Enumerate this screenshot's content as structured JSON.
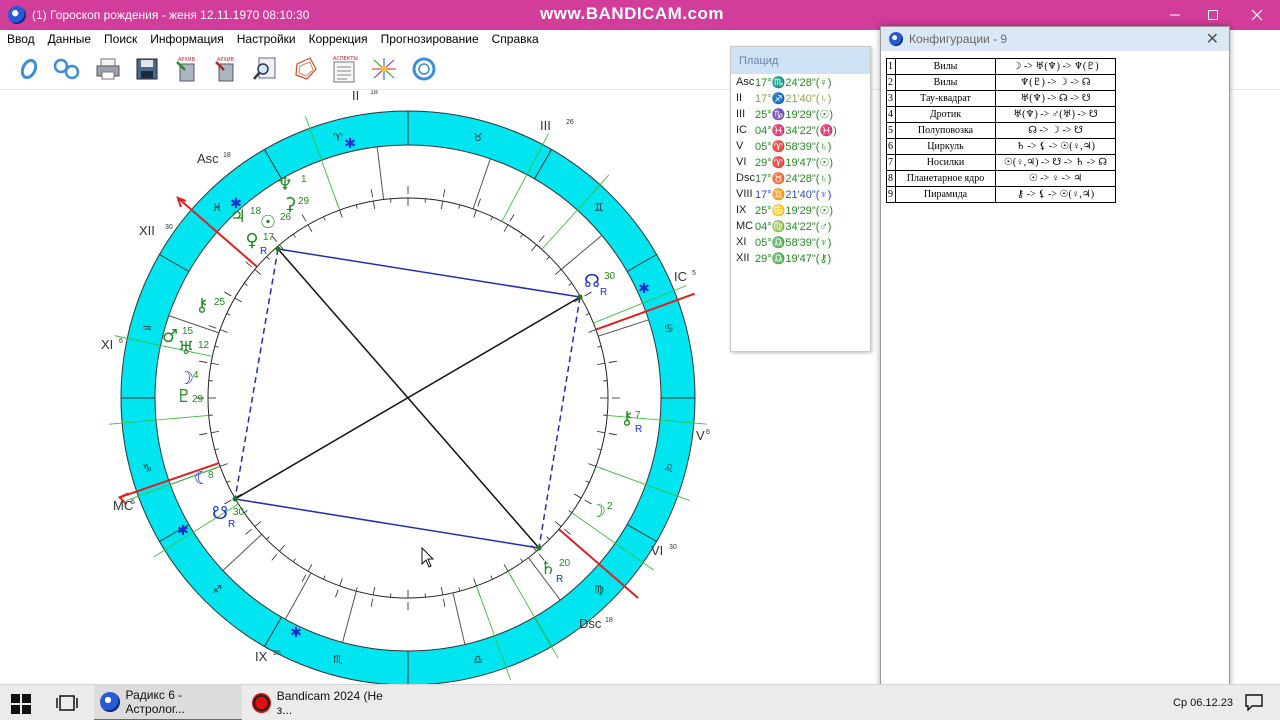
{
  "window": {
    "title": "(1) Гороскоп рождения - женя 12.11.1970  08:10:30",
    "watermark": "www.BANDICAM.com"
  },
  "menu": [
    "Ввод",
    "Данные",
    "Поиск",
    "Информация",
    "Настройки",
    "Коррекция",
    "Прогнозирование",
    "Справка"
  ],
  "toolbar": {
    "icons": [
      "rings-icon",
      "double-rings-icon",
      "printer-icon",
      "floppy-disk-icon",
      "archive-in-icon",
      "archive-out-icon",
      "magnifier-icon",
      "polygon-icon",
      "aspects-list-icon",
      "star-graph-icon",
      "refresh-icon"
    ],
    "archive_label": "АРХИВ",
    "aspects_label": "АСПЕКТЫ"
  },
  "chart": {
    "cusps": [
      {
        "label": "Asc",
        "sup": "18"
      },
      {
        "label": "II",
        "sup": "18"
      },
      {
        "label": "III",
        "sup": "26"
      },
      {
        "label": "IC",
        "sup": "5"
      },
      {
        "label": "V",
        "sup": "6"
      },
      {
        "label": "VI",
        "sup": "30"
      },
      {
        "label": "Dsc",
        "sup": "18"
      },
      {
        "label": "IX",
        "sup": "26"
      },
      {
        "label": "MC",
        "sup": "5"
      },
      {
        "label": "XI",
        "sup": "6"
      },
      {
        "label": "XII",
        "sup": "30"
      }
    ],
    "zodiac_glyphs": [
      "♏",
      "♐",
      "♑",
      "♒",
      "♓",
      "♈",
      "♉",
      "♊",
      "♋",
      "♌",
      "♍",
      "♎"
    ],
    "planets": [
      {
        "glyph": "♆",
        "degree": "1",
        "retro": ""
      },
      {
        "glyph": "⚳",
        "degree": "29",
        "retro": ""
      },
      {
        "glyph": "♃",
        "degree": "18",
        "retro": ""
      },
      {
        "glyph": "☉",
        "degree": "26",
        "retro": ""
      },
      {
        "glyph": "♀",
        "degree": "17",
        "retro": "R"
      },
      {
        "glyph": "☊",
        "degree": "30",
        "retro": "R"
      },
      {
        "glyph": "⚷",
        "degree": "25",
        "retro": ""
      },
      {
        "glyph": "♂",
        "degree": "15",
        "retro": ""
      },
      {
        "glyph": "♅",
        "degree": "12",
        "retro": ""
      },
      {
        "glyph": "☽",
        "degree": "4",
        "retro": ""
      },
      {
        "glyph": "♇",
        "degree": "29",
        "retro": ""
      },
      {
        "glyph": "⚷",
        "degree": "7",
        "retro": "R"
      },
      {
        "glyph": "☾",
        "degree": "8",
        "retro": ""
      },
      {
        "glyph": "☋",
        "degree": "30",
        "retro": "R"
      },
      {
        "glyph": "☽",
        "degree": "2",
        "retro": ""
      },
      {
        "glyph": "♄",
        "degree": "20",
        "retro": "R"
      }
    ]
  },
  "placidus": {
    "title": "Плацид",
    "rows": [
      {
        "house": "Asc",
        "value": "17°♏24'28\"(♀)",
        "tone": "green"
      },
      {
        "house": "II",
        "value": "17°♐21'40\"(♄)",
        "tone": "olive"
      },
      {
        "house": "III",
        "value": "25°♑19'29\"(☉)",
        "tone": "green"
      },
      {
        "house": "IC",
        "value": "04°♓34'22\"(♓)",
        "tone": "green"
      },
      {
        "house": "V",
        "value": "05°♈58'39\"(♄)",
        "tone": "green"
      },
      {
        "house": "VI",
        "value": "29°♈19'47\"(☉)",
        "tone": "green"
      },
      {
        "house": "Dsc",
        "value": "17°♉24'28\"(♄)",
        "tone": "green"
      },
      {
        "house": "VIII",
        "value": "17°♊21'40\"(♆)",
        "tone": "blue"
      },
      {
        "house": "IX",
        "value": "25°♋19'29\"(☉)",
        "tone": "green"
      },
      {
        "house": "MC",
        "value": "04°♍34'22\"(♂)",
        "tone": "green"
      },
      {
        "house": "XI",
        "value": "05°♎58'39\"(♆)",
        "tone": "green"
      },
      {
        "house": "XII",
        "value": "29°♎19'47\"(⚷)",
        "tone": "green"
      }
    ]
  },
  "config": {
    "title": "Конфигурации - 9",
    "close": "✕",
    "rows": [
      {
        "n": "1",
        "name": "Вилы",
        "formula": "☽ -> ♅(♆) -> ♆(♇)"
      },
      {
        "n": "2",
        "name": "Вилы",
        "formula": "♆(♇) -> ☽ -> ☊"
      },
      {
        "n": "3",
        "name": "Тау-квадрат",
        "formula": "♅(♆) -> ☊ -> ☋"
      },
      {
        "n": "4",
        "name": "Дротик",
        "formula": "♅(♆) -> ♂(♅) -> ☋"
      },
      {
        "n": "5",
        "name": "Полуповозка",
        "formula": "☊ -> ☽ -> ☋"
      },
      {
        "n": "6",
        "name": "Циркуль",
        "formula": "♄ -> ⚸ -> ☉(♀,♃)"
      },
      {
        "n": "7",
        "name": "Носилки",
        "formula": "☉(♀,♃) -> ☋ -> ♄ -> ☊"
      },
      {
        "n": "8",
        "name": "Планетарное ядро",
        "formula": "☉ -> ♀ -> ♃"
      },
      {
        "n": "9",
        "name": "Пирамида",
        "formula": "⚷ -> ⚸ -> ☉(♀,♃)"
      }
    ]
  },
  "taskbar": {
    "items": [
      {
        "label": "Радикс 6 - Астролог...",
        "active": true
      },
      {
        "label": "Bandicam 2024 (Не з...",
        "active": false
      }
    ],
    "clock": "Ср 06.12.23"
  },
  "colors": {
    "titlebar": "#d23c9b",
    "zodiac_ring": "#00e5f0",
    "aspect_blue": "#1f2fb0",
    "planet_green": "#1f8a1f",
    "axis_red": "#e02020"
  }
}
